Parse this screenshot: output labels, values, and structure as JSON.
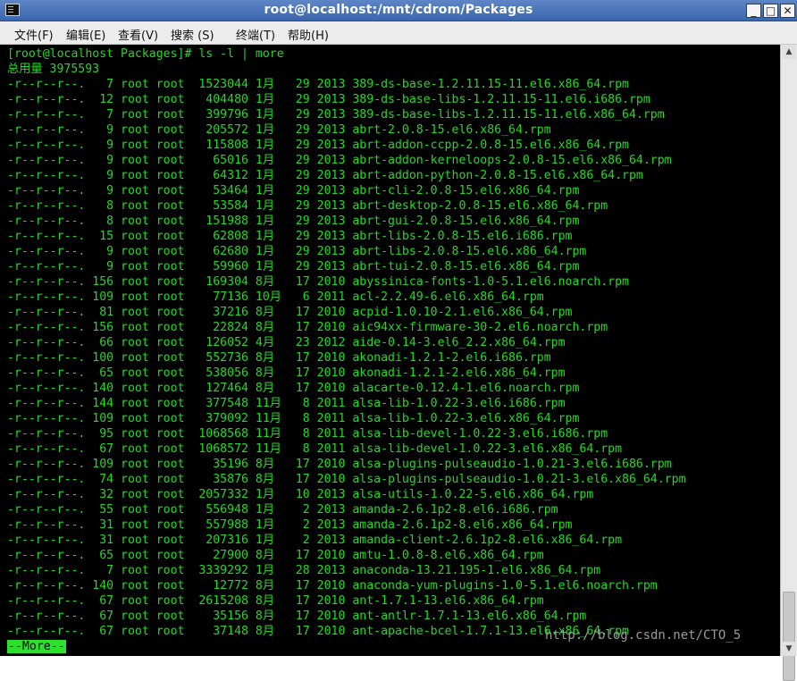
{
  "window": {
    "title": "root@localhost:/mnt/cdrom/Packages",
    "minimize": "_",
    "maximize": "□",
    "close": "✕"
  },
  "menu": [
    "文件(F)",
    "编辑(E)",
    "查看(V)",
    "搜索 (S)",
    "终端(T)",
    "帮助(H)"
  ],
  "terminal": {
    "prompt": "[root@localhost Packages]# ls -l | more",
    "total": "总用量 3975593",
    "lines": [
      "-r--r--r--.   7 root root  1523044 1月   29 2013 389-ds-base-1.2.11.15-11.el6.x86_64.rpm",
      "-r--r--r--.  12 root root   404480 1月   29 2013 389-ds-base-libs-1.2.11.15-11.el6.i686.rpm",
      "-r--r--r--.   7 root root   399796 1月   29 2013 389-ds-base-libs-1.2.11.15-11.el6.x86_64.rpm",
      "-r--r--r--.   9 root root   205572 1月   29 2013 abrt-2.0.8-15.el6.x86_64.rpm",
      "-r--r--r--.   9 root root   115808 1月   29 2013 abrt-addon-ccpp-2.0.8-15.el6.x86_64.rpm",
      "-r--r--r--.   9 root root    65016 1月   29 2013 abrt-addon-kerneloops-2.0.8-15.el6.x86_64.rpm",
      "-r--r--r--.   9 root root    64312 1月   29 2013 abrt-addon-python-2.0.8-15.el6.x86_64.rpm",
      "-r--r--r--.   9 root root    53464 1月   29 2013 abrt-cli-2.0.8-15.el6.x86_64.rpm",
      "-r--r--r--.   8 root root    53584 1月   29 2013 abrt-desktop-2.0.8-15.el6.x86_64.rpm",
      "-r--r--r--.   8 root root   151988 1月   29 2013 abrt-gui-2.0.8-15.el6.x86_64.rpm",
      "-r--r--r--.  15 root root    62808 1月   29 2013 abrt-libs-2.0.8-15.el6.i686.rpm",
      "-r--r--r--.   9 root root    62680 1月   29 2013 abrt-libs-2.0.8-15.el6.x86_64.rpm",
      "-r--r--r--.   9 root root    59960 1月   29 2013 abrt-tui-2.0.8-15.el6.x86_64.rpm",
      "-r--r--r--. 156 root root   169304 8月   17 2010 abyssinica-fonts-1.0-5.1.el6.noarch.rpm",
      "-r--r--r--. 109 root root    77136 10月   6 2011 acl-2.2.49-6.el6.x86_64.rpm",
      "-r--r--r--.  81 root root    37216 8月   17 2010 acpid-1.0.10-2.1.el6.x86_64.rpm",
      "-r--r--r--. 156 root root    22824 8月   17 2010 aic94xx-firmware-30-2.el6.noarch.rpm",
      "-r--r--r--.  66 root root   126052 4月   23 2012 aide-0.14-3.el6_2.2.x86_64.rpm",
      "-r--r--r--. 100 root root   552736 8月   17 2010 akonadi-1.2.1-2.el6.i686.rpm",
      "-r--r--r--.  65 root root   538056 8月   17 2010 akonadi-1.2.1-2.el6.x86_64.rpm",
      "-r--r--r--. 140 root root   127464 8月   17 2010 alacarte-0.12.4-1.el6.noarch.rpm",
      "-r--r--r--. 144 root root   377548 11月   8 2011 alsa-lib-1.0.22-3.el6.i686.rpm",
      "-r--r--r--. 109 root root   379092 11月   8 2011 alsa-lib-1.0.22-3.el6.x86_64.rpm",
      "-r--r--r--.  95 root root  1068568 11月   8 2011 alsa-lib-devel-1.0.22-3.el6.i686.rpm",
      "-r--r--r--.  67 root root  1068572 11月   8 2011 alsa-lib-devel-1.0.22-3.el6.x86_64.rpm",
      "-r--r--r--. 109 root root    35196 8月   17 2010 alsa-plugins-pulseaudio-1.0.21-3.el6.i686.rpm",
      "-r--r--r--.  74 root root    35876 8月   17 2010 alsa-plugins-pulseaudio-1.0.21-3.el6.x86_64.rpm",
      "-r--r--r--.  32 root root  2057332 1月   10 2013 alsa-utils-1.0.22-5.el6.x86_64.rpm",
      "-r--r--r--.  55 root root   556948 1月    2 2013 amanda-2.6.1p2-8.el6.i686.rpm",
      "-r--r--r--.  31 root root   557988 1月    2 2013 amanda-2.6.1p2-8.el6.x86_64.rpm",
      "-r--r--r--.  31 root root   207316 1月    2 2013 amanda-client-2.6.1p2-8.el6.x86_64.rpm",
      "-r--r--r--.  65 root root    27900 8月   17 2010 amtu-1.0.8-8.el6.x86_64.rpm",
      "-r--r--r--.   7 root root  3339292 1月   28 2013 anaconda-13.21.195-1.el6.x86_64.rpm",
      "-r--r--r--. 140 root root    12772 8月   17 2010 anaconda-yum-plugins-1.0-5.1.el6.noarch.rpm",
      "-r--r--r--.  67 root root  2615208 8月   17 2010 ant-1.7.1-13.el6.x86_64.rpm",
      "-r--r--r--.  67 root root    35156 8月   17 2010 ant-antlr-1.7.1-13.el6.x86_64.rpm",
      "-r--r--r--.  67 root root    37148 8月   17 2010 ant-apache-bcel-1.7.1-13.el6.x86_64.rpm"
    ],
    "more": "--More--"
  },
  "watermark": "http://blog.csdn.net/CTO_5",
  "colors": {
    "terminal_fg": "#28d628",
    "terminal_bg": "#000000",
    "titlebar": "#4a74b8"
  },
  "icons": [
    "terminal-icon",
    "minimize-icon",
    "maximize-icon",
    "close-icon",
    "scroll-up-arrow-icon",
    "scroll-down-arrow-icon"
  ]
}
